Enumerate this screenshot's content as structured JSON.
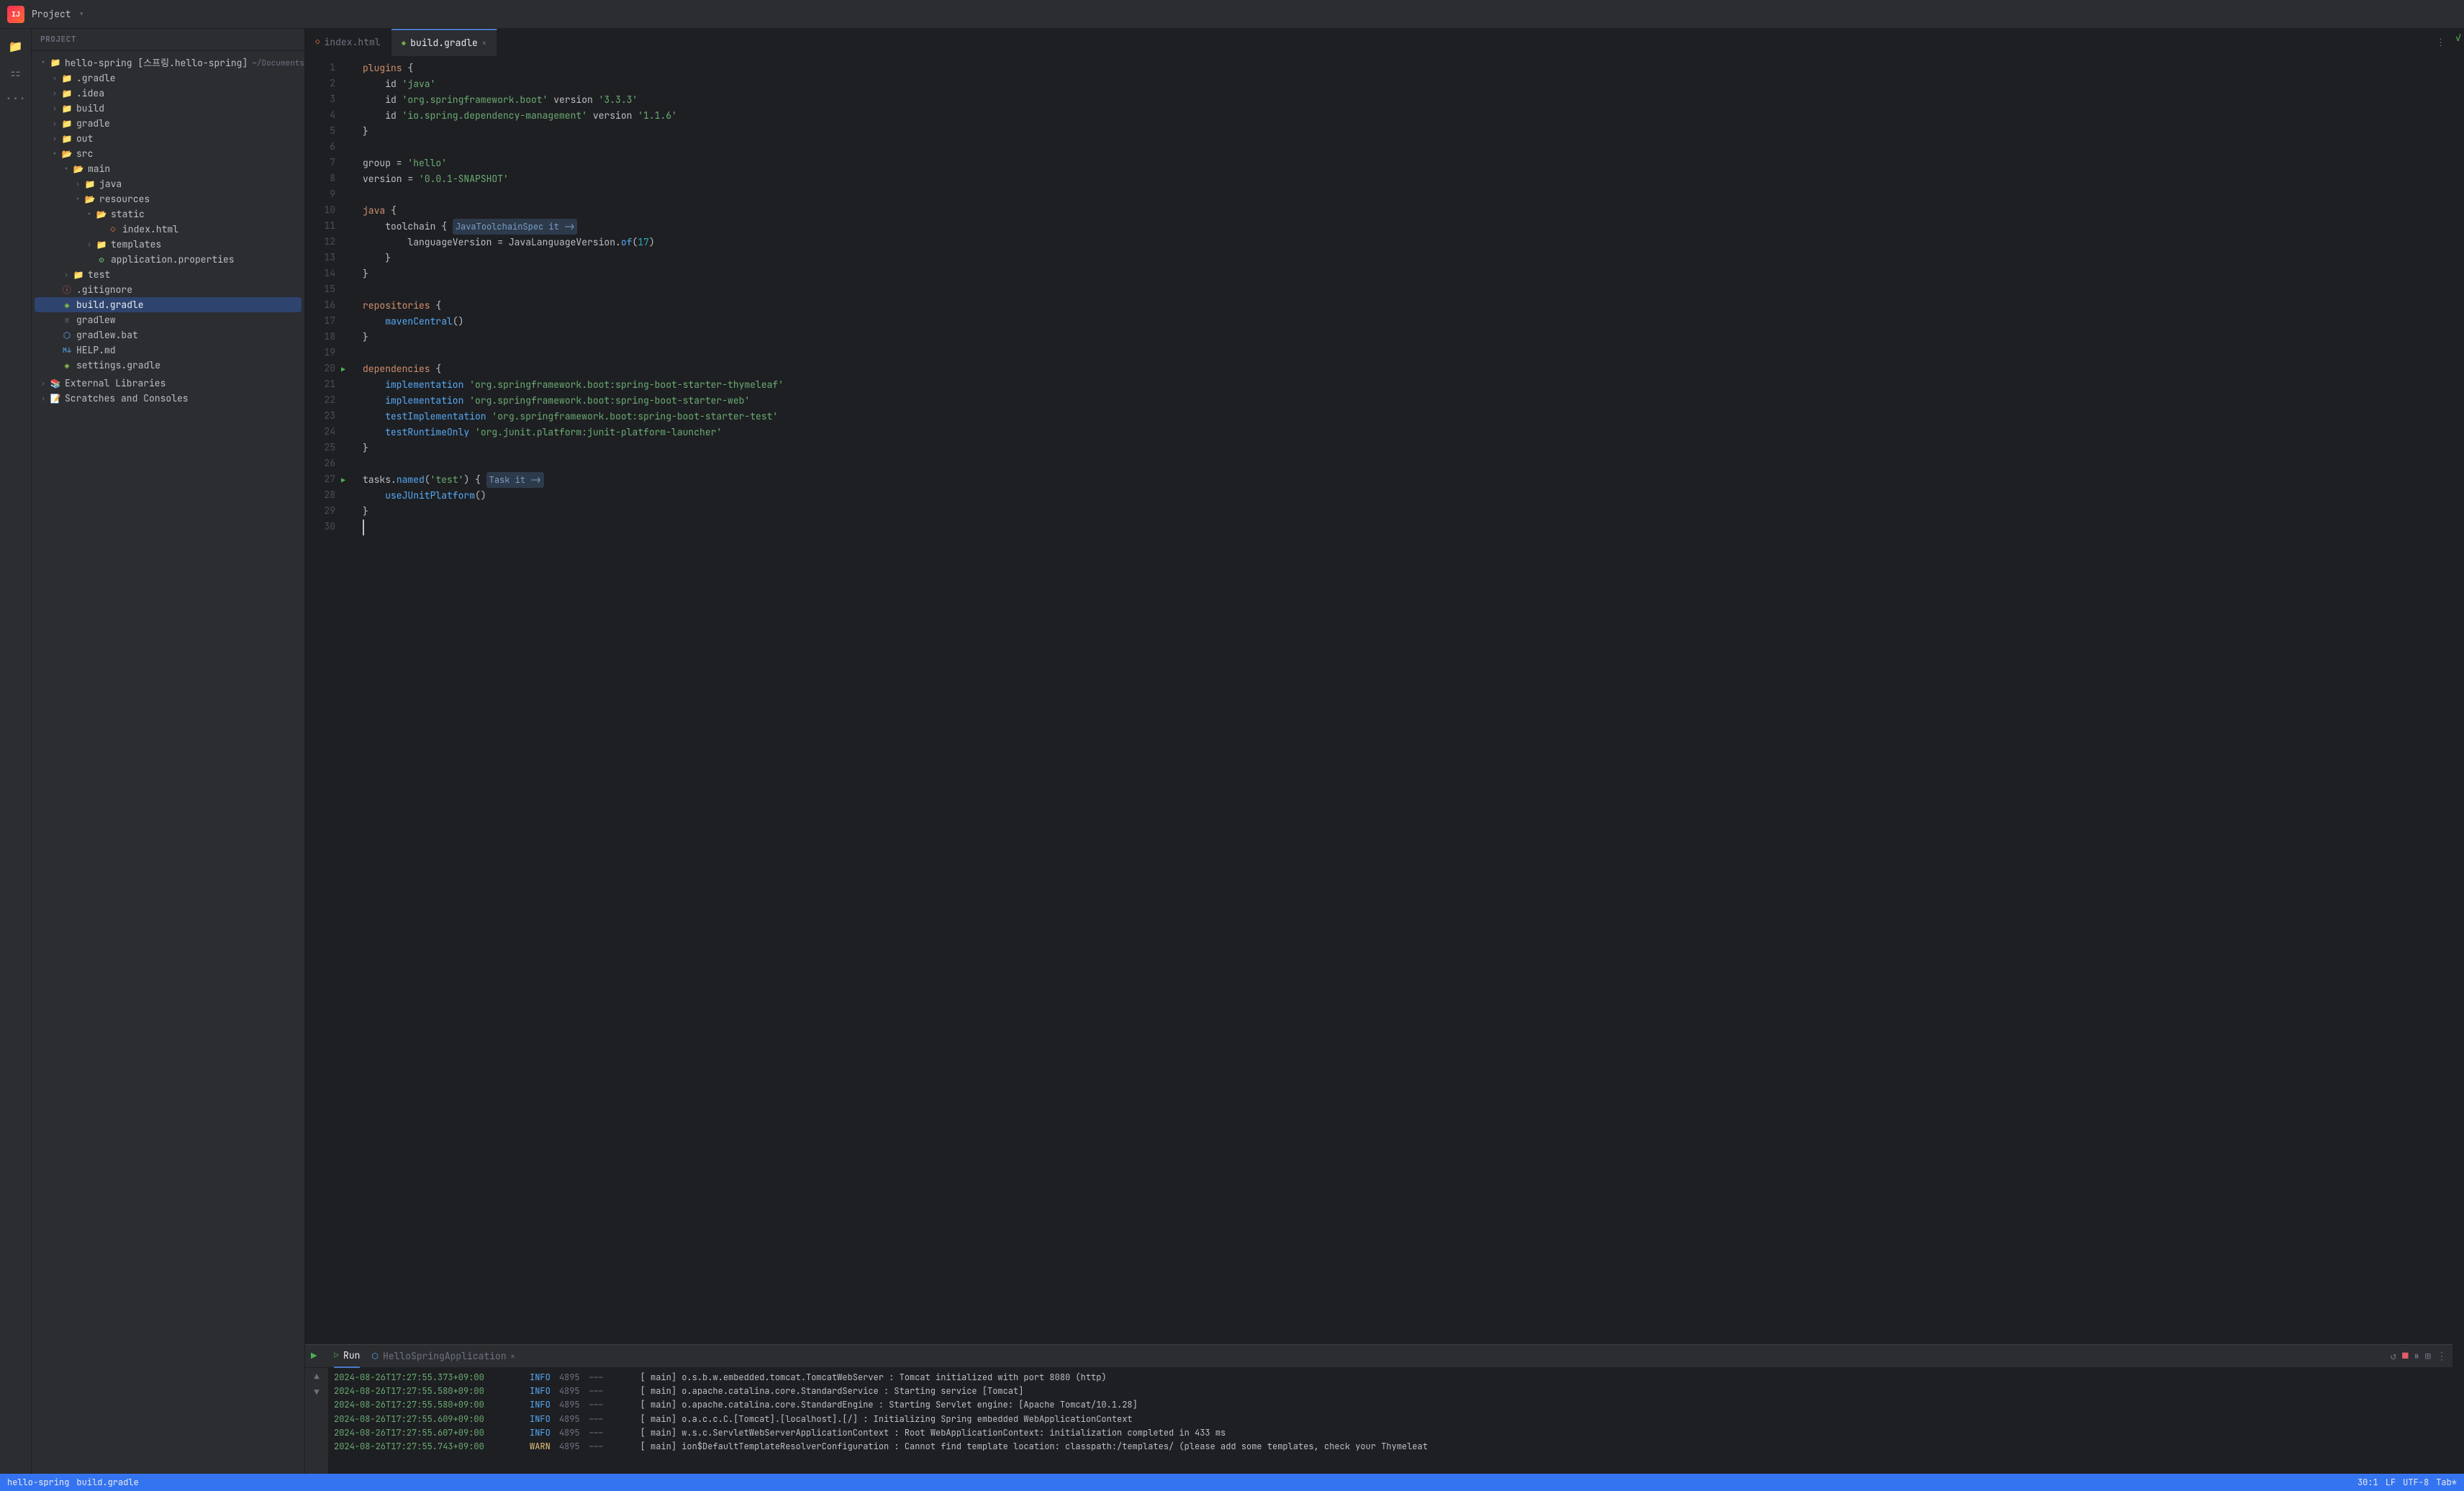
{
  "project": {
    "title": "Project",
    "chevron": "▾",
    "root": {
      "name": "hello-spring [스프링.hello-spring]",
      "path": "~/Documents/스프링/hello-spring",
      "children": [
        {
          "id": "gradle-dir",
          "label": ".gradle",
          "type": "folder",
          "depth": 1,
          "expanded": false
        },
        {
          "id": "idea-dir",
          "label": ".idea",
          "type": "folder",
          "depth": 1,
          "expanded": false
        },
        {
          "id": "build-dir",
          "label": "build",
          "type": "folder",
          "depth": 1,
          "expanded": false
        },
        {
          "id": "gradle-dir2",
          "label": "gradle",
          "type": "folder",
          "depth": 1,
          "expanded": false
        },
        {
          "id": "out-dir",
          "label": "out",
          "type": "folder",
          "depth": 1,
          "expanded": false
        },
        {
          "id": "src-dir",
          "label": "src",
          "type": "folder",
          "depth": 1,
          "expanded": true
        },
        {
          "id": "main-dir",
          "label": "main",
          "type": "folder",
          "depth": 2,
          "expanded": true
        },
        {
          "id": "java-dir",
          "label": "java",
          "type": "folder",
          "depth": 3,
          "expanded": false
        },
        {
          "id": "resources-dir",
          "label": "resources",
          "type": "folder",
          "depth": 3,
          "expanded": true
        },
        {
          "id": "static-dir",
          "label": "static",
          "type": "folder",
          "depth": 4,
          "expanded": true
        },
        {
          "id": "index-html",
          "label": "index.html",
          "type": "html",
          "depth": 5,
          "expanded": false
        },
        {
          "id": "templates-dir",
          "label": "templates",
          "type": "folder",
          "depth": 4,
          "expanded": false
        },
        {
          "id": "app-props",
          "label": "application.properties",
          "type": "props",
          "depth": 4,
          "expanded": false
        },
        {
          "id": "test-dir",
          "label": "test",
          "type": "folder",
          "depth": 2,
          "expanded": false
        },
        {
          "id": "gitignore",
          "label": ".gitignore",
          "type": "gitignore",
          "depth": 1,
          "expanded": false
        },
        {
          "id": "build-gradle",
          "label": "build.gradle",
          "type": "gradle",
          "depth": 1,
          "expanded": false,
          "selected": true
        },
        {
          "id": "gradlew-file",
          "label": "gradlew",
          "type": "file",
          "depth": 1,
          "expanded": false
        },
        {
          "id": "gradlew-bat",
          "label": "gradlew.bat",
          "type": "bat",
          "depth": 1,
          "expanded": false
        },
        {
          "id": "help-md",
          "label": "HELP.md",
          "type": "md",
          "depth": 1,
          "expanded": false
        },
        {
          "id": "settings-gradle",
          "label": "settings.gradle",
          "type": "gradle",
          "depth": 1,
          "expanded": false
        }
      ]
    },
    "external_libraries": "External Libraries",
    "scratches": "Scratches and Consoles"
  },
  "tabs": [
    {
      "id": "index-html-tab",
      "label": "index.html",
      "icon": "◇",
      "active": false,
      "closable": false
    },
    {
      "id": "build-gradle-tab",
      "label": "build.gradle",
      "icon": "◈",
      "active": true,
      "closable": true
    }
  ],
  "code": {
    "lines": [
      {
        "num": 1,
        "tokens": [
          {
            "t": "kw",
            "v": "plugins"
          },
          {
            "t": "plain",
            "v": " {"
          }
        ]
      },
      {
        "num": 2,
        "tokens": [
          {
            "t": "plain",
            "v": "    id "
          },
          {
            "t": "str",
            "v": "'java'"
          }
        ]
      },
      {
        "num": 3,
        "tokens": [
          {
            "t": "plain",
            "v": "    id "
          },
          {
            "t": "str",
            "v": "'org.springframework.boot'"
          },
          {
            "t": "plain",
            "v": " version "
          },
          {
            "t": "str",
            "v": "'3.3.3'"
          }
        ]
      },
      {
        "num": 4,
        "tokens": [
          {
            "t": "plain",
            "v": "    id "
          },
          {
            "t": "str",
            "v": "'io.spring.dependency-management'"
          },
          {
            "t": "plain",
            "v": " version "
          },
          {
            "t": "str",
            "v": "'1.1.6'"
          }
        ]
      },
      {
        "num": 5,
        "tokens": [
          {
            "t": "plain",
            "v": "}"
          }
        ]
      },
      {
        "num": 6,
        "tokens": []
      },
      {
        "num": 7,
        "tokens": [
          {
            "t": "plain",
            "v": "group = "
          },
          {
            "t": "str",
            "v": "'hello'"
          }
        ]
      },
      {
        "num": 8,
        "tokens": [
          {
            "t": "plain",
            "v": "version = "
          },
          {
            "t": "str",
            "v": "'0.0.1-SNAPSHOT'"
          }
        ]
      },
      {
        "num": 9,
        "tokens": []
      },
      {
        "num": 10,
        "tokens": [
          {
            "t": "kw",
            "v": "java"
          },
          {
            "t": "plain",
            "v": " {"
          }
        ]
      },
      {
        "num": 11,
        "tokens": [
          {
            "t": "plain",
            "v": "    toolchain { "
          },
          {
            "t": "hint",
            "v": "JavaToolchainSpec it ->"
          }
        ]
      },
      {
        "num": 12,
        "tokens": [
          {
            "t": "plain",
            "v": "        languageVersion = JavaLanguageVersion."
          },
          {
            "t": "func",
            "v": "of"
          },
          {
            "t": "plain",
            "v": "("
          },
          {
            "t": "num",
            "v": "17"
          },
          {
            "t": "plain",
            "v": ")"
          }
        ]
      },
      {
        "num": 13,
        "tokens": [
          {
            "t": "plain",
            "v": "    }"
          }
        ]
      },
      {
        "num": 14,
        "tokens": [
          {
            "t": "plain",
            "v": "}"
          }
        ]
      },
      {
        "num": 15,
        "tokens": []
      },
      {
        "num": 16,
        "tokens": [
          {
            "t": "kw",
            "v": "repositories"
          },
          {
            "t": "plain",
            "v": " {"
          }
        ]
      },
      {
        "num": 17,
        "tokens": [
          {
            "t": "plain",
            "v": "    "
          },
          {
            "t": "func",
            "v": "mavenCentral"
          },
          {
            "t": "plain",
            "v": "()"
          }
        ]
      },
      {
        "num": 18,
        "tokens": [
          {
            "t": "plain",
            "v": "}"
          }
        ]
      },
      {
        "num": 19,
        "tokens": []
      },
      {
        "num": 20,
        "tokens": [
          {
            "t": "kw",
            "v": "dependencies"
          },
          {
            "t": "plain",
            "v": " {"
          }
        ],
        "runnable": true
      },
      {
        "num": 21,
        "tokens": [
          {
            "t": "plain",
            "v": "    "
          },
          {
            "t": "func",
            "v": "implementation"
          },
          {
            "t": "plain",
            "v": " "
          },
          {
            "t": "str",
            "v": "'org.springframework.boot:spring-boot-starter-thymeleaf'"
          }
        ]
      },
      {
        "num": 22,
        "tokens": [
          {
            "t": "plain",
            "v": "    "
          },
          {
            "t": "func",
            "v": "implementation"
          },
          {
            "t": "plain",
            "v": " "
          },
          {
            "t": "str",
            "v": "'org.springframework.boot:spring-boot-starter-web'"
          }
        ]
      },
      {
        "num": 23,
        "tokens": [
          {
            "t": "plain",
            "v": "    "
          },
          {
            "t": "func",
            "v": "testImplementation"
          },
          {
            "t": "plain",
            "v": " "
          },
          {
            "t": "str",
            "v": "'org.springframework.boot:spring-boot-starter-test'"
          }
        ]
      },
      {
        "num": 24,
        "tokens": [
          {
            "t": "plain",
            "v": "    "
          },
          {
            "t": "func",
            "v": "testRuntimeOnly"
          },
          {
            "t": "plain",
            "v": " "
          },
          {
            "t": "str",
            "v": "'org.junit.platform:junit-platform-launcher'"
          }
        ]
      },
      {
        "num": 25,
        "tokens": [
          {
            "t": "plain",
            "v": "}"
          }
        ]
      },
      {
        "num": 26,
        "tokens": []
      },
      {
        "num": 27,
        "tokens": [
          {
            "t": "plain",
            "v": "tasks."
          },
          {
            "t": "func",
            "v": "named"
          },
          {
            "t": "plain",
            "v": "("
          },
          {
            "t": "str",
            "v": "'test'"
          },
          {
            "t": "plain",
            "v": ")"
          },
          {
            "t": "plain",
            "v": " { "
          },
          {
            "t": "hint",
            "v": "Task it ->"
          }
        ],
        "runnable": true
      },
      {
        "num": 28,
        "tokens": [
          {
            "t": "plain",
            "v": "    "
          },
          {
            "t": "func",
            "v": "useJUnitPlatform"
          },
          {
            "t": "plain",
            "v": "()"
          }
        ]
      },
      {
        "num": 29,
        "tokens": [
          {
            "t": "plain",
            "v": "}"
          }
        ]
      },
      {
        "num": 30,
        "tokens": [],
        "cursor": true
      }
    ]
  },
  "run_panel": {
    "tab_label": "Run",
    "app_label": "HelloSpringApplication",
    "console_lines": [
      {
        "time": "2024-08-26T17:27:55.373+09:00",
        "level": "INFO",
        "pid": "4895",
        "thread": "---",
        "who": "[           main]",
        "class": "o.s.b.w.embedded.tomcat.TomcatWebServer",
        "message": ": Tomcat initialized with port 8080 (http)"
      },
      {
        "time": "2024-08-26T17:27:55.580+09:00",
        "level": "INFO",
        "pid": "4895",
        "thread": "---",
        "who": "[           main]",
        "class": "o.apache.catalina.core.StandardService",
        "message": ": Starting service [Tomcat]"
      },
      {
        "time": "2024-08-26T17:27:55.580+09:00",
        "level": "INFO",
        "pid": "4895",
        "thread": "---",
        "who": "[           main]",
        "class": "o.apache.catalina.core.StandardEngine",
        "message": ": Starting Servlet engine: [Apache Tomcat/10.1.28]"
      },
      {
        "time": "2024-08-26T17:27:55.609+09:00",
        "level": "INFO",
        "pid": "4895",
        "thread": "---",
        "who": "[           main]",
        "class": "o.a.c.c.C.[Tomcat].[localhost].[/]",
        "message": ": Initializing Spring embedded WebApplicationContext"
      },
      {
        "time": "2024-08-26T17:27:55.607+09:00",
        "level": "INFO",
        "pid": "4895",
        "thread": "---",
        "who": "[           main]",
        "class": "w.s.c.ServletWebServerApplicationContext",
        "message": ": Root WebApplicationContext: initialization completed in 433 ms"
      },
      {
        "time": "2024-08-26T17:27:55.743+09:00",
        "level": "WARN",
        "pid": "4895",
        "thread": "---",
        "who": "[           main]",
        "class": "ion$DefaultTemplateResolverConfiguration",
        "message": ": Cannot find template location: classpath:/templates/ (please add some templates, check your Thymeleat"
      }
    ]
  },
  "status_bar": {
    "branch": "hello-spring",
    "file": "build.gradle",
    "position": "30:1",
    "encoding": "UTF-8",
    "indent": "Tab*",
    "lf": "LF"
  },
  "icons": {
    "folder": "📁",
    "folder_open": "📂",
    "html_file": "◇",
    "gradle_file": "◈",
    "props_file": "⚙",
    "git_file": "ⓘ",
    "md_file": "M↓",
    "bat_file": "⬡",
    "run": "▶"
  }
}
